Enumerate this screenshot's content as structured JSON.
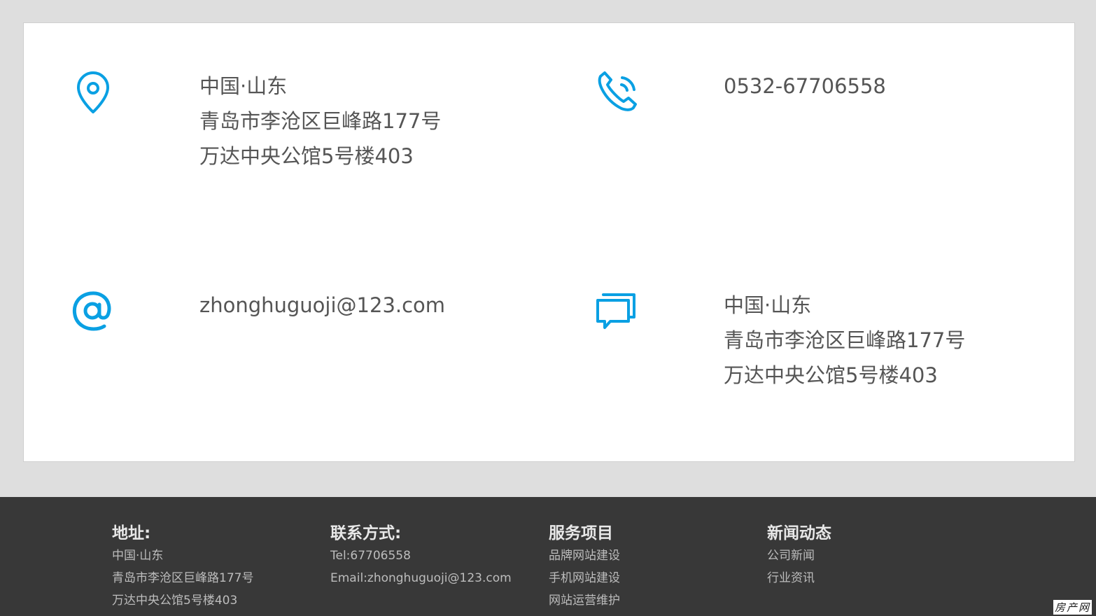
{
  "accent_color": "#0aa0e3",
  "contact_card": {
    "address": {
      "icon": "map-pin-icon",
      "lines": [
        "中国·山东",
        "青岛市李沧区巨峰路177号",
        "万达中央公馆5号楼403"
      ]
    },
    "phone": {
      "icon": "phone-icon",
      "value": "0532-67706558"
    },
    "email": {
      "icon": "at-sign-icon",
      "value": "zhonghuguoji@123.com"
    },
    "message": {
      "icon": "chat-bubbles-icon",
      "lines": [
        "中国·山东",
        "青岛市李沧区巨峰路177号",
        "万达中央公馆5号楼403"
      ]
    }
  },
  "footer": {
    "address": {
      "heading": "地址:",
      "lines": [
        "中国·山东",
        "青岛市李沧区巨峰路177号",
        "万达中央公馆5号楼403"
      ]
    },
    "contact": {
      "heading": "联系方式:",
      "lines": [
        "Tel:67706558",
        "Email:zhonghuguoji@123.com"
      ]
    },
    "services": {
      "heading": "服务项目",
      "links": [
        "品牌网站建设",
        "手机网站建设",
        "网站运营维护"
      ]
    },
    "news": {
      "heading": "新闻动态",
      "links": [
        "公司新闻",
        "行业资讯"
      ]
    }
  },
  "watermark": "房产网"
}
